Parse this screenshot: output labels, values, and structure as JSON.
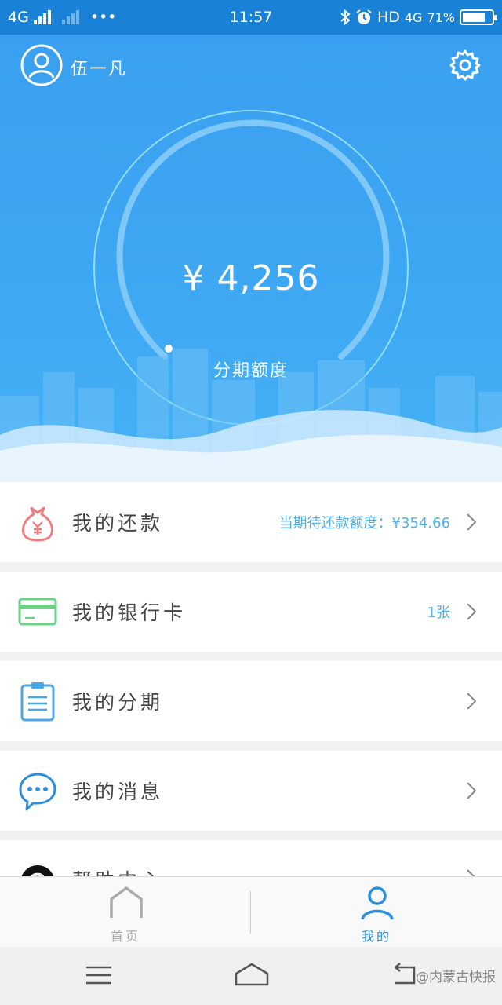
{
  "status_bar": {
    "network": "4G",
    "dots": "•••",
    "time": "11:57",
    "hd": "HD",
    "network2": "4G",
    "battery": "71%"
  },
  "header": {
    "username": "伍一凡"
  },
  "credit": {
    "amount": "¥ 4,256",
    "label": "分期额度"
  },
  "menu": {
    "items": [
      {
        "label": "我的还款",
        "extra": "当期待还款额度：¥354.66",
        "icon": "money-bag-icon"
      },
      {
        "label": "我的银行卡",
        "extra": "1张",
        "icon": "bank-card-icon"
      },
      {
        "label": "我的分期",
        "extra": "",
        "icon": "clipboard-icon"
      },
      {
        "label": "我的消息",
        "extra": "",
        "icon": "chat-bubble-icon"
      },
      {
        "label": "帮助中心",
        "extra": "",
        "icon": "help-icon"
      }
    ]
  },
  "tabbar": {
    "home": "首页",
    "mine": "我的"
  },
  "navbar": {
    "watermark": "@内蒙古快报"
  },
  "colors": {
    "hero_blue": "#3ea8f3",
    "accent_text": "#4fb0e8",
    "active_tab": "#2b8fe0",
    "repay_icon": "#ef7f7f",
    "card_icon": "#6fd08a"
  }
}
